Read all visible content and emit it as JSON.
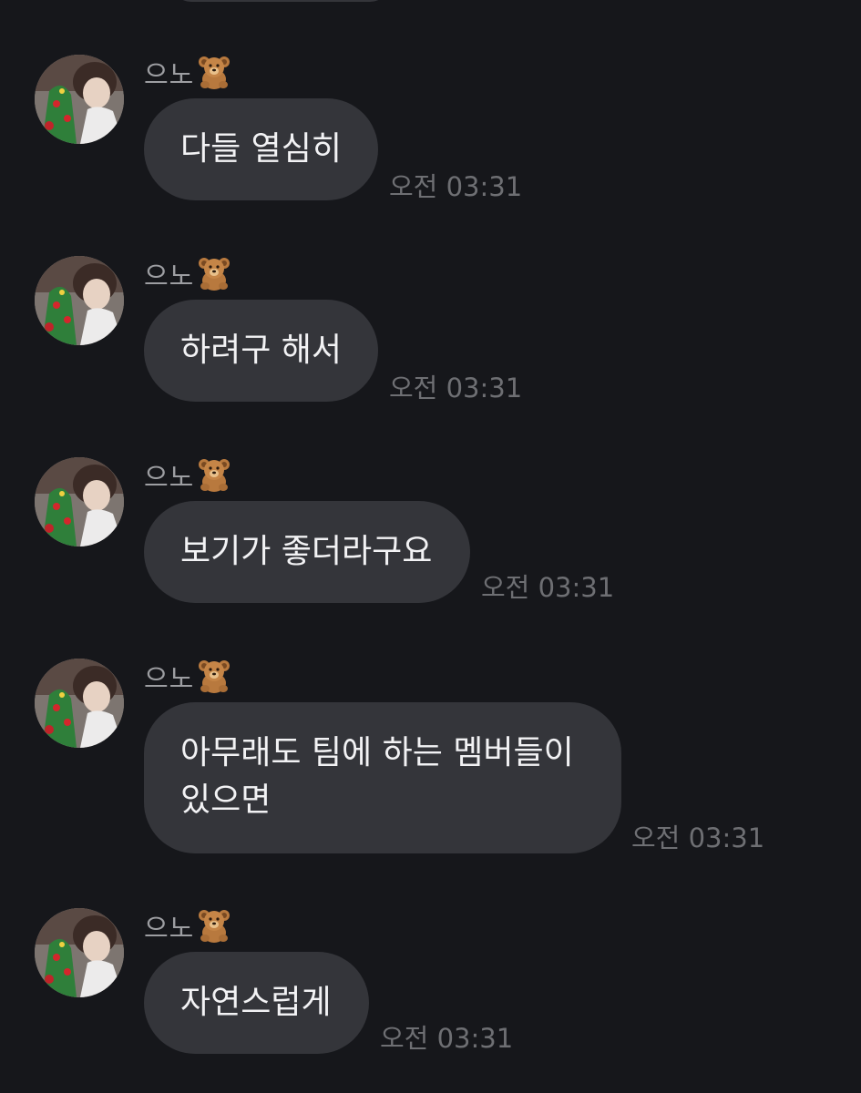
{
  "colors": {
    "background": "#16171b",
    "bubble": "#34353a",
    "message_text": "#f2f2f4",
    "sender_text": "#9d9ea2",
    "time_text": "#6e6f73"
  },
  "messages": [
    {
      "sender": "으노",
      "sender_icon": "teddy-bear-icon",
      "lines": [
        "다들 열심히"
      ],
      "time": "오전 03:31"
    },
    {
      "sender": "으노",
      "sender_icon": "teddy-bear-icon",
      "lines": [
        "하려구 해서"
      ],
      "time": "오전 03:31"
    },
    {
      "sender": "으노",
      "sender_icon": "teddy-bear-icon",
      "lines": [
        "보기가 좋더라구요"
      ],
      "time": "오전 03:31"
    },
    {
      "sender": "으노",
      "sender_icon": "teddy-bear-icon",
      "lines": [
        "아무래도 팀에 하는 멤버들이",
        "있으면"
      ],
      "time": "오전 03:31"
    },
    {
      "sender": "으노",
      "sender_icon": "teddy-bear-icon",
      "lines": [
        "자연스럽게"
      ],
      "time": "오전 03:31"
    }
  ]
}
